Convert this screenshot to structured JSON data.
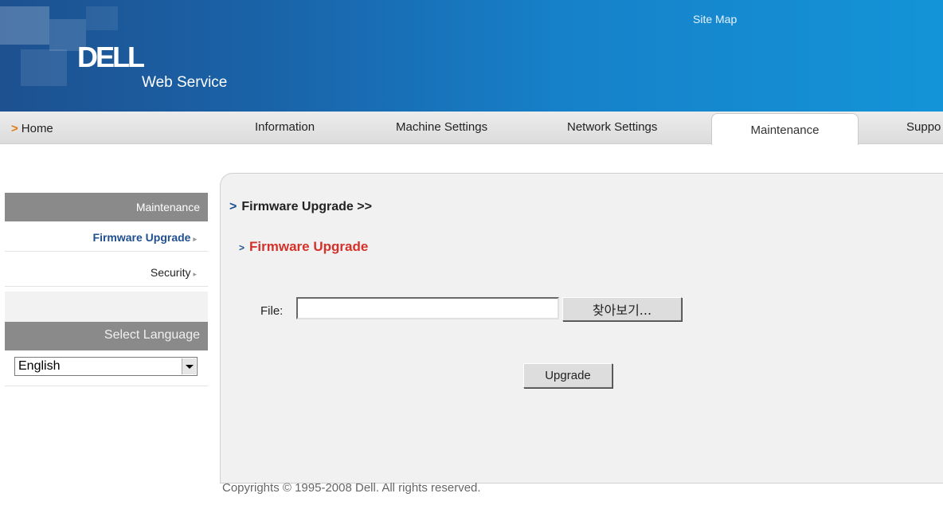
{
  "header": {
    "logo_text": "DELL",
    "logo_sub": "Web Service",
    "site_map": "Site Map"
  },
  "nav": {
    "home": "Home",
    "tabs": [
      {
        "label": "Information"
      },
      {
        "label": "Machine Settings"
      },
      {
        "label": "Network Settings"
      },
      {
        "label": "Maintenance",
        "active": true
      },
      {
        "label": "Suppo"
      }
    ]
  },
  "sidebar": {
    "section_title": "Maintenance",
    "items": [
      {
        "label": "Firmware Upgrade",
        "active": true
      },
      {
        "label": "Security"
      }
    ],
    "language_title": "Select Language",
    "language_value": "English"
  },
  "main": {
    "breadcrumb": "Firmware Upgrade >>",
    "section_title": "Firmware Upgrade",
    "file_label": "File:",
    "file_value": "",
    "browse_button": "찾아보기...",
    "upgrade_button": "Upgrade"
  },
  "footer": {
    "copyright": "Copyrights © 1995-2008 Dell. All rights reserved."
  },
  "colors": {
    "header_blue": "#1a64aa",
    "active_link": "#1f4f8f",
    "section_red": "#d4312a",
    "sidebar_header": "#8a8a8a",
    "home_arrow": "#e07b10"
  }
}
